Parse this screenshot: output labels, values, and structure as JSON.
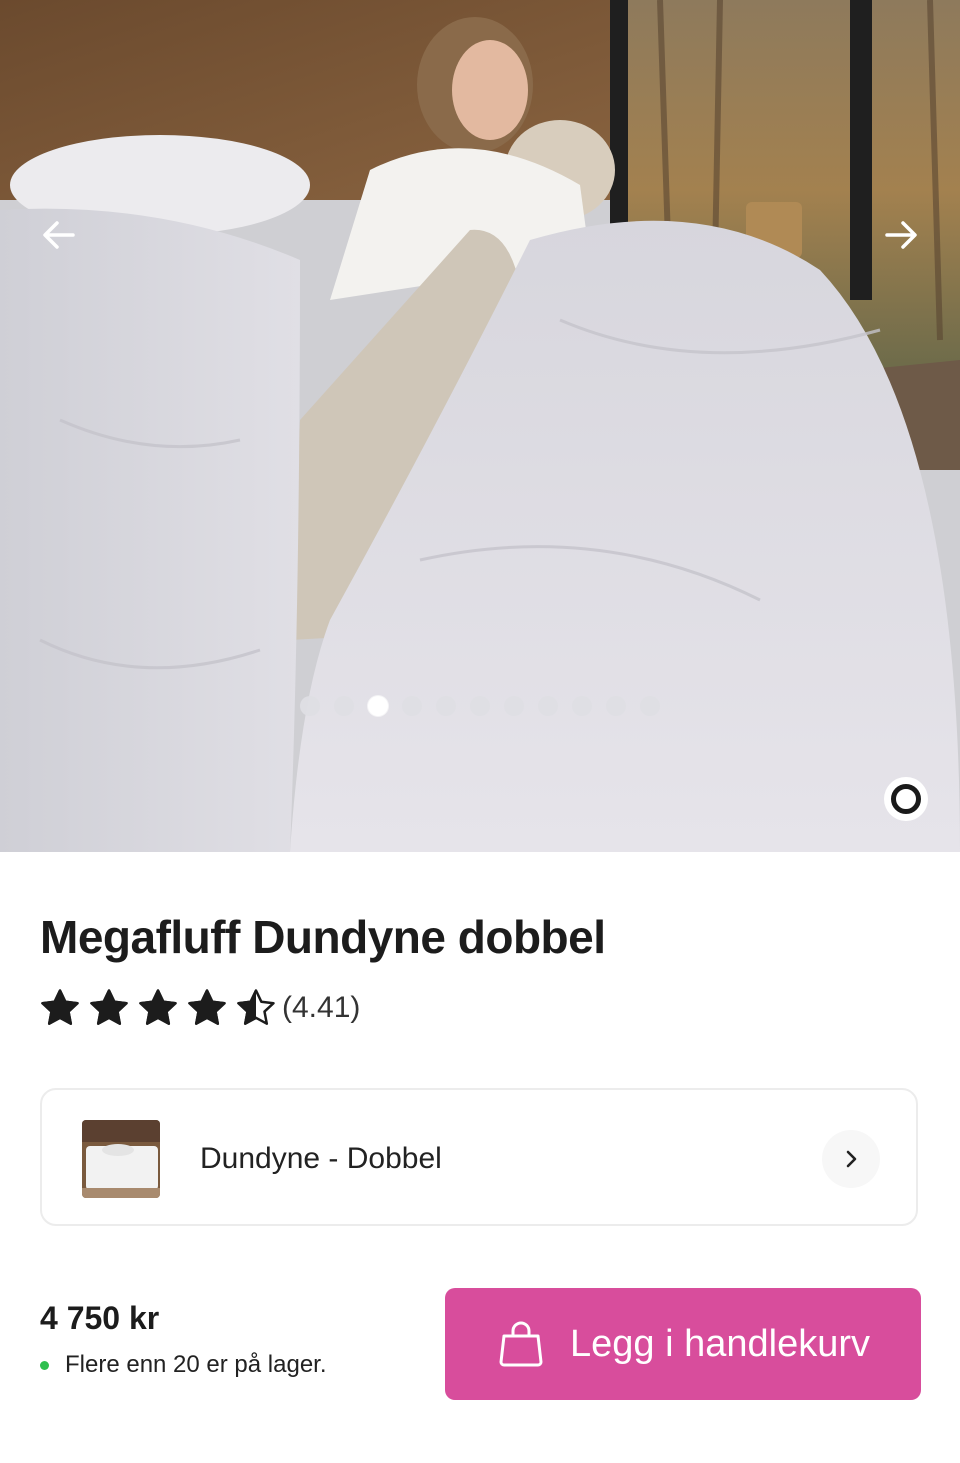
{
  "gallery": {
    "image_count": 11,
    "active_index": 2,
    "prev_icon": "arrow-left-icon",
    "next_icon": "arrow-right-icon",
    "view_icon": "ring-icon"
  },
  "product": {
    "title": "Megafluff Dundyne dobbel",
    "rating": 4.41,
    "rating_text": "(4.41)",
    "stars_max": 5
  },
  "variant": {
    "label": "Dundyne - Dobbel",
    "chevron_icon": "chevron-right-icon"
  },
  "purchase": {
    "price": "4 750 kr",
    "stock_text": "Flere enn 20 er på lager.",
    "stock_color": "#2fbf4f",
    "cart_label": "Legg i handlekurv",
    "cart_icon": "shopping-bag-icon",
    "accent_color": "#d84d9c"
  }
}
